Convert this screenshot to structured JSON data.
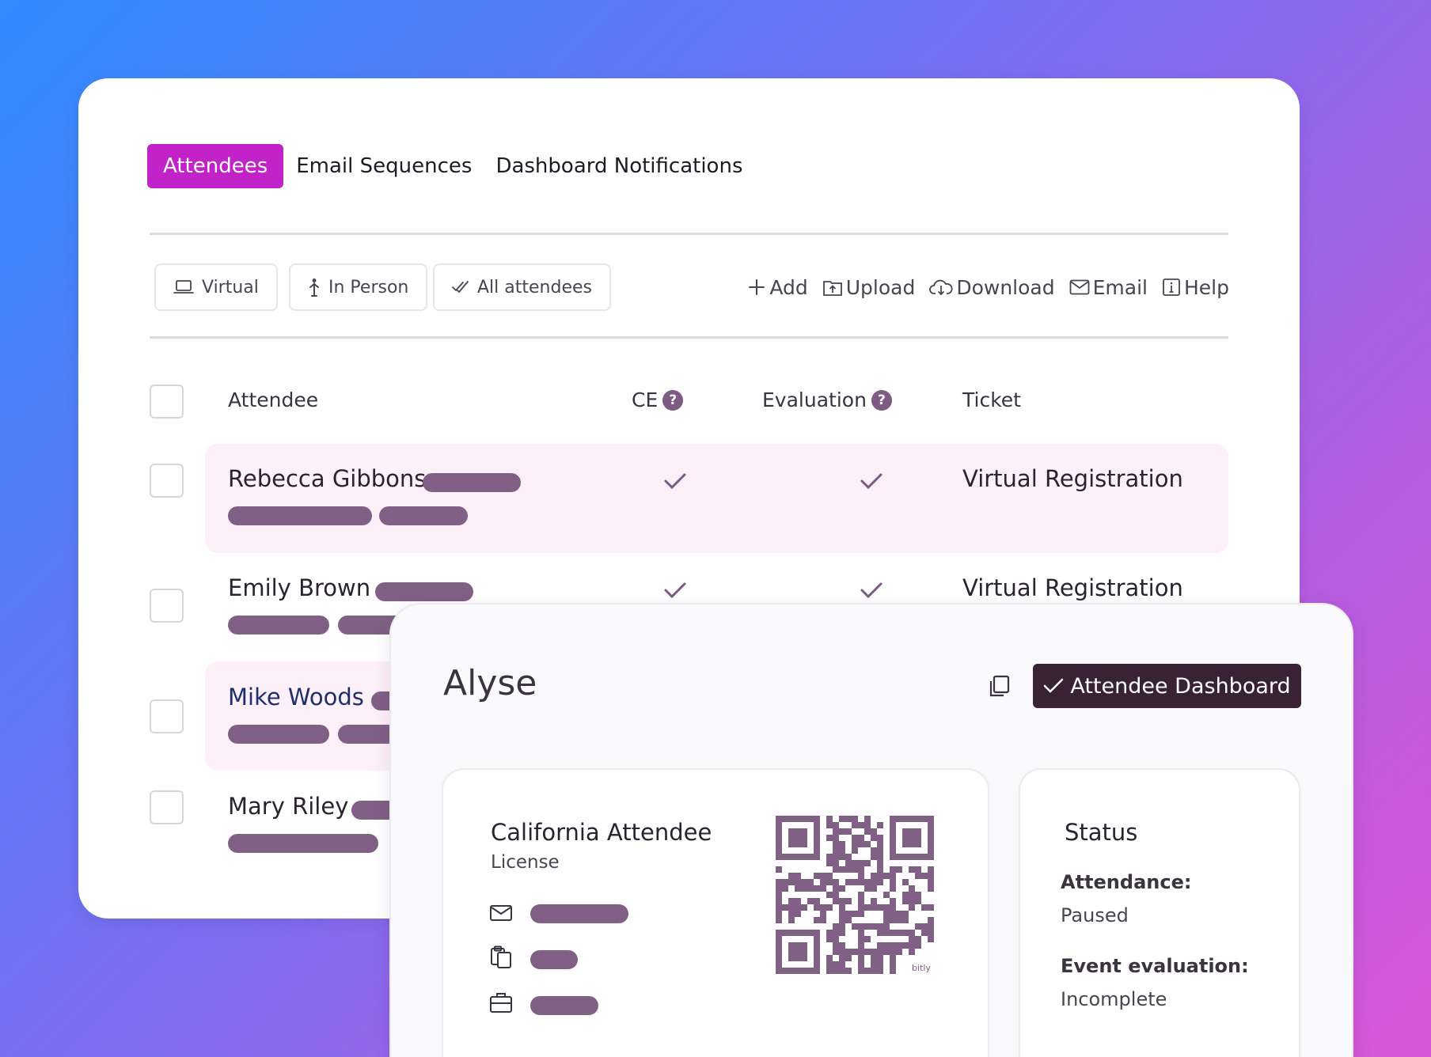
{
  "tabs": [
    {
      "label": "Attendees",
      "active": true
    },
    {
      "label": "Email Sequences",
      "active": false
    },
    {
      "label": "Dashboard Notifications",
      "active": false
    }
  ],
  "filters": [
    {
      "label": "Virtual",
      "icon": "laptop-icon"
    },
    {
      "label": "In Person",
      "icon": "person-icon"
    },
    {
      "label": "All attendees",
      "icon": "double-check-icon"
    }
  ],
  "actions": [
    {
      "label": "Add",
      "icon": "plus-icon"
    },
    {
      "label": "Upload",
      "icon": "upload-icon"
    },
    {
      "label": "Download",
      "icon": "cloud-download-icon"
    },
    {
      "label": "Email",
      "icon": "mail-icon"
    },
    {
      "label": "Help",
      "icon": "info-icon"
    }
  ],
  "table": {
    "headers": {
      "attendee": "Attendee",
      "ce": "CE",
      "evaluation": "Evaluation",
      "ticket": "Ticket"
    },
    "rows": [
      {
        "name": "Rebecca Gibbons",
        "ce": true,
        "evaluation": true,
        "ticket": "Virtual Registration",
        "highlighted": true
      },
      {
        "name": "Emily Brown",
        "ce": true,
        "evaluation": true,
        "ticket": "Virtual Registration",
        "highlighted": false
      },
      {
        "name": "Mike Woods",
        "highlighted": true
      },
      {
        "name": "Mary Riley",
        "highlighted": false
      }
    ]
  },
  "panel": {
    "title": "Alyse",
    "dashboard_button": "Attendee Dashboard",
    "license": {
      "title": "California Attendee",
      "subtitle": "License",
      "qr_watermark": "bitly"
    },
    "status": {
      "title": "Status",
      "attendance_label": "Attendance:",
      "attendance_value": "Paused",
      "evaluation_label": "Event evaluation:",
      "evaluation_value": "Incomplete"
    }
  },
  "colors": {
    "accent": "#c223c9",
    "pill": "#806084",
    "row_highlight": "#fdf0f8",
    "dark_button": "#3a2236"
  }
}
